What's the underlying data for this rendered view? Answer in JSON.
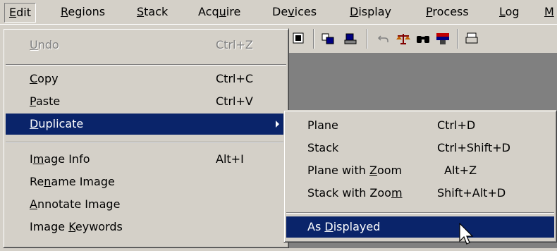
{
  "menubar": [
    {
      "label": "Edit",
      "mn": "E",
      "rest": "dit",
      "active": true
    },
    {
      "label": "Regions",
      "mn": "R",
      "rest": "egions"
    },
    {
      "label": "Stack",
      "mn": "S",
      "rest": "tack"
    },
    {
      "label": "Acquire",
      "pre": "Acq",
      "mn": "u",
      "rest": "ire"
    },
    {
      "label": "Devices",
      "pre": "De",
      "mn": "v",
      "rest": "ices"
    },
    {
      "label": "Display",
      "mn": "D",
      "rest": "isplay"
    },
    {
      "label": "Process",
      "mn": "P",
      "rest": "rocess"
    },
    {
      "label": "Log",
      "mn": "L",
      "rest": "og"
    },
    {
      "label": "M",
      "mn": "M",
      "rest": ""
    }
  ],
  "edit_menu": {
    "undo": {
      "label": "Undo",
      "mn": "U",
      "rest": "ndo",
      "shortcut": "Ctrl+Z"
    },
    "copy": {
      "mn": "C",
      "rest": "opy",
      "shortcut": "Ctrl+C"
    },
    "paste": {
      "mn": "P",
      "rest": "aste",
      "shortcut": "Ctrl+V"
    },
    "duplicate": {
      "mn": "D",
      "rest": "uplicate"
    },
    "image_info": {
      "pre": "I",
      "mn": "m",
      "rest": "age Info",
      "shortcut": "Alt+I"
    },
    "rename_image": {
      "pre": "Re",
      "mn": "n",
      "rest": "ame Image"
    },
    "annotate_image": {
      "mn": "A",
      "rest": "nnotate Image"
    },
    "image_keywords": {
      "pre": "Image ",
      "mn": "K",
      "rest": "eywords"
    }
  },
  "duplicate_submenu": {
    "plane": {
      "label": "Plane",
      "shortcut": "Ctrl+D"
    },
    "stack": {
      "label": "Stack",
      "shortcut": "Ctrl+Shift+D"
    },
    "plane_with_zoom": {
      "pre": "Plane with ",
      "mn": "Z",
      "rest": "oom",
      "shortcut": "Alt+Z"
    },
    "stack_with_zoom": {
      "pre": "Stack with Zoo",
      "mn": "m",
      "rest": "",
      "shortcut": "Shift+Alt+D"
    },
    "as_displayed": {
      "pre": "As ",
      "mn": "D",
      "rest": "isplayed"
    }
  },
  "colors": {
    "highlight": "#0a246a",
    "face": "#d4d0c8",
    "workspace": "#808080"
  },
  "icons": [
    "image-window-icon",
    "region-copy-icon",
    "region-paste-icon",
    "undo-icon",
    "balance-icon",
    "binoculars-icon",
    "color-monitor-icon",
    "printer-icon"
  ]
}
